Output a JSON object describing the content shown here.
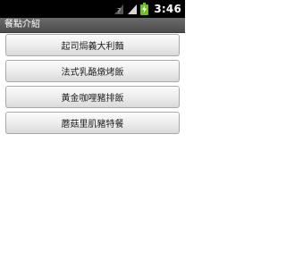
{
  "status_bar": {
    "time": "3:46",
    "icons": [
      "unknown-signal-icon",
      "signal-icon",
      "battery-charging-icon"
    ],
    "battery_color": "#6fbf1f"
  },
  "title_bar": {
    "title": "餐點介紹"
  },
  "menu": {
    "items": [
      {
        "label": "起司焗義大利麵"
      },
      {
        "label": "法式乳酪燉烤飯"
      },
      {
        "label": "黃金咖哩豬排飯"
      },
      {
        "label": "蘑菇里肌豬特餐"
      }
    ]
  }
}
